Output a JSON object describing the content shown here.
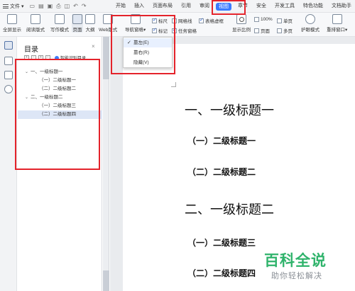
{
  "menubar": {
    "file_label": "文件",
    "items": [
      {
        "label": "开始"
      },
      {
        "label": "插入"
      },
      {
        "label": "页面布局"
      },
      {
        "label": "引用"
      },
      {
        "label": "审阅"
      },
      {
        "label": "视图",
        "active": true
      },
      {
        "label": "章节"
      },
      {
        "label": "安全"
      },
      {
        "label": "开发工具"
      },
      {
        "label": "特色功能"
      },
      {
        "label": "文档助手"
      }
    ]
  },
  "ribbon": {
    "fullscreen": "全屏显示",
    "reading_mode": "阅读版式",
    "writing_mode": "写作模式",
    "page_view": "页面",
    "outline_view": "大纲",
    "web_view": "Web版式",
    "nav_pane": "导航窗格",
    "ruler": "标尺",
    "gridlines": "网格线",
    "table_lines": "表格虚框",
    "markup": "标记",
    "task_pane": "任务窗格",
    "display_ratio": "显示比例",
    "zoom_value": "100%",
    "single_page": "单页",
    "multi_page": "多页",
    "eye_protect": "护眼模式",
    "rearrange_window": "重排窗口"
  },
  "dropdown": {
    "items": [
      {
        "label": "靠左(E)",
        "checked": true
      },
      {
        "label": "靠右(R)",
        "checked": false
      },
      {
        "label": "隐藏(V)",
        "checked": false
      }
    ]
  },
  "navpane": {
    "title": "目录",
    "close": "×",
    "smart_toc": "智能识别目录",
    "outline": [
      {
        "label": "一、一级标题一",
        "level": 1
      },
      {
        "label": "（一）二级标题一",
        "level": 2
      },
      {
        "label": "（二）二级标题二",
        "level": 2
      },
      {
        "label": "二、一级标题二",
        "level": 1
      },
      {
        "label": "（一）二级标题三",
        "level": 2
      },
      {
        "label": "（二）二级标题四",
        "level": 2,
        "selected": true
      }
    ]
  },
  "document": {
    "h1_a": "一、一级标题一",
    "h2_a": "（一）二级标题一",
    "h2_b": "（二）二级标题二",
    "h1_b": "二、一级标题二",
    "h2_c": "（一）二级标题三",
    "h2_d": "（二）二级标题四"
  },
  "watermark": {
    "brand": "百科全说",
    "tagline": "助你轻松解决"
  },
  "colors": {
    "accent": "#3b7bff",
    "highlight_box": "#e4232b",
    "watermark_green": "#2fb36b"
  }
}
